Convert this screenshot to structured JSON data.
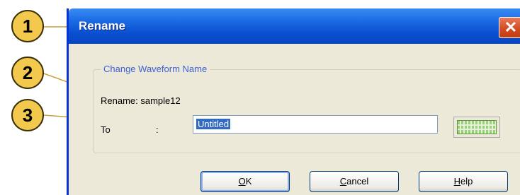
{
  "dialog": {
    "title": "Rename",
    "close_symbol": "✕",
    "group": {
      "legend": "Change Waveform Name",
      "rename_label": "Rename: sample12",
      "to_label": "To",
      "colon": ":",
      "input_value": "Untitled"
    },
    "buttons": {
      "ok_prefix": "",
      "ok_accel": "O",
      "ok_rest": "K",
      "cancel_accel": "C",
      "cancel_rest": "ancel",
      "help_accel": "H",
      "help_rest": "elp"
    }
  },
  "callouts": {
    "one": "1",
    "two": "2",
    "three": "3"
  },
  "colors": {
    "titlebar": "#0a4fd0",
    "callout_fill": "#f2c94c",
    "leader_line": "#c8a040",
    "close_button": "#d04a1f"
  },
  "icons": {
    "keyboard": "keyboard-icon",
    "close": "close-icon"
  }
}
